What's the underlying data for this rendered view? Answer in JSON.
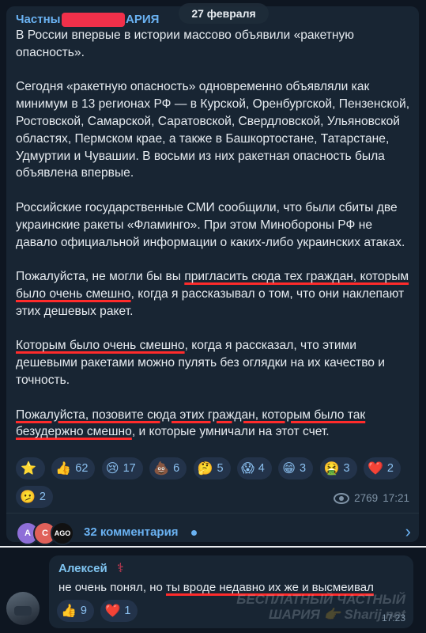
{
  "date": "27 февраля",
  "channel": {
    "name_prefix": "Частны",
    "name_suffix": "АРИЯ"
  },
  "post": {
    "p1": "В России впервые в истории массово объявили «ракетную опасность».",
    "p2": "Сегодня «ракетную опасность» одновременно объявляли как минимум в 13 регионах РФ — в Курской, Оренбургской, Пензенской, Ростовской, Самарской, Саратовской, Свердловской, Ульяновской областях, Пермском крае, а также в Башкортостане, Татарстане, Удмуртии и Чувашии. В восьми из них ракетная опасность была объявлена впервые.",
    "p3": "Российские государственные СМИ сообщили, что были сбиты две украинские ракеты «Фламинго». При этом Минобороны РФ не давало официальной информации о каких-либо украинских атаках.",
    "p4a": "Пожалуйста, не могли бы вы ",
    "p4b": "пригласить сюда тех граждан, которым было очень смешно",
    "p4c": ", когда я рассказывал о том, что они наклепают этих дешевых ракет.",
    "p5a": "Которым было очень смешно",
    "p5b": ", когда я рассказал, что этими дешевыми ракетами можно пулять без оглядки на их качество и точность.",
    "p6a": "Пожалуйста, позовите сюда этих граждан, которым было так безудержно смешно",
    "p6b": ", и которые умничали на этот счет."
  },
  "reactions": [
    {
      "icon": "star-icon",
      "emoji": "⭐",
      "count": ""
    },
    {
      "icon": "thumbs-up-icon",
      "emoji": "👍",
      "count": "62"
    },
    {
      "icon": "crying-face-icon",
      "emoji": "😢",
      "count": "17"
    },
    {
      "icon": "poop-icon",
      "emoji": "💩",
      "count": "6"
    },
    {
      "icon": "thinking-face-icon",
      "emoji": "🤔",
      "count": "5"
    },
    {
      "icon": "screaming-face-icon",
      "emoji": "😱",
      "count": "4"
    },
    {
      "icon": "grinning-face-icon",
      "emoji": "😁",
      "count": "3"
    },
    {
      "icon": "nauseated-face-icon",
      "emoji": "🤮",
      "count": "3"
    },
    {
      "icon": "heart-icon",
      "emoji": "❤️",
      "count": "2"
    },
    {
      "icon": "confused-face-icon",
      "emoji": "🫤",
      "count": "2"
    }
  ],
  "stats": {
    "views": "2769",
    "time": "17:21"
  },
  "comments": {
    "label": "32 комментария",
    "avatars": [
      {
        "letter": "A",
        "color": "#8e6fd8"
      },
      {
        "letter": "C",
        "color": "#e0615a"
      },
      {
        "letter": "AGO",
        "color": "#111111"
      }
    ]
  },
  "reply": {
    "author": "Алексей",
    "text": "не очень понял, но ты вроде недавно их же и высмеивал",
    "reactions": [
      {
        "icon": "thumbs-up-icon",
        "emoji": "👍",
        "count": "9"
      },
      {
        "icon": "heart-icon",
        "emoji": "❤️",
        "count": "1"
      }
    ],
    "watermark_line1": "БЕСПЛАТНЫЙ ЧАСТНЫЙ",
    "watermark_line2": "ШАРИЯ 👉 Sharij.net",
    "time": "17:23"
  },
  "colors": {
    "background": "#0e1621",
    "bubble": "#182533",
    "accent": "#6ab2f2",
    "underline": "#ff2b2b"
  }
}
